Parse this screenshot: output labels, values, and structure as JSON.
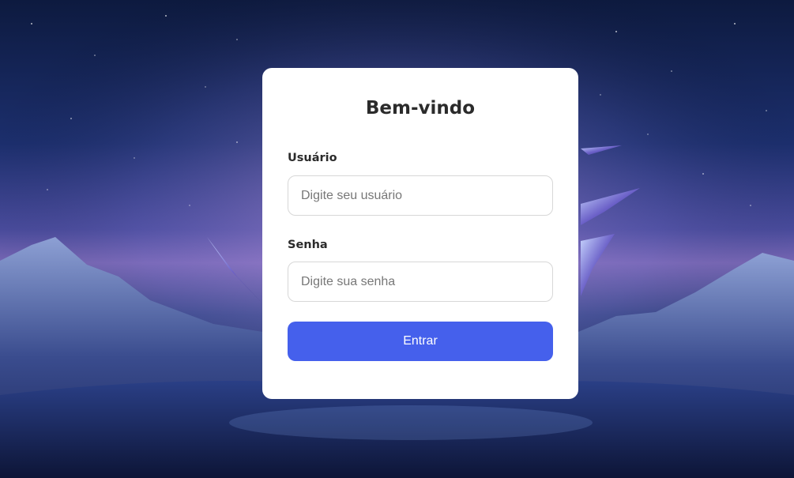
{
  "login": {
    "title": "Bem-vindo",
    "username_label": "Usuário",
    "username_placeholder": "Digite seu usuário",
    "username_value": "",
    "password_label": "Senha",
    "password_placeholder": "Digite sua senha",
    "password_value": "",
    "submit_label": "Entrar"
  },
  "colors": {
    "accent": "#4560ec",
    "card_bg": "#ffffff",
    "text": "#2b2b2b",
    "placeholder": "#777777",
    "border": "#d7d7d7"
  }
}
